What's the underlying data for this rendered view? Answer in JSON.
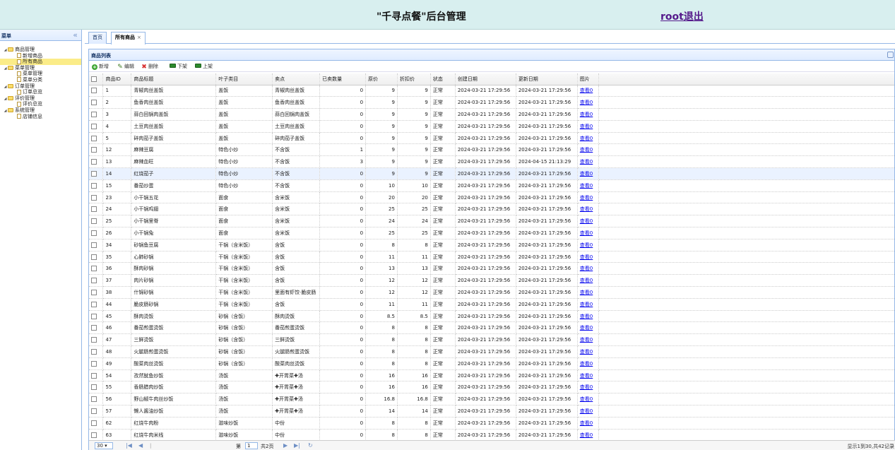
{
  "header": {
    "title": "\"千寻点餐\"后台管理",
    "logout": "root退出"
  },
  "sidebar": {
    "title": "菜单",
    "collapse": "«",
    "tree": [
      {
        "label": "商品管理",
        "level": 0,
        "type": "folder"
      },
      {
        "label": "新增商品",
        "level": 1,
        "type": "file"
      },
      {
        "label": "所有商品",
        "level": 1,
        "type": "file",
        "selected": true
      },
      {
        "label": "菜单管理",
        "level": 0,
        "type": "folder"
      },
      {
        "label": "菜单管理",
        "level": 1,
        "type": "file"
      },
      {
        "label": "菜单分类",
        "level": 1,
        "type": "file"
      },
      {
        "label": "订单管理",
        "level": 0,
        "type": "folder"
      },
      {
        "label": "订单总览",
        "level": 1,
        "type": "file"
      },
      {
        "label": "评价管理",
        "level": 0,
        "type": "folder"
      },
      {
        "label": "评价总览",
        "level": 1,
        "type": "file"
      },
      {
        "label": "系统管理",
        "level": 0,
        "type": "folder"
      },
      {
        "label": "店铺信息",
        "level": 1,
        "type": "file"
      }
    ]
  },
  "tabs": {
    "home": "首页",
    "all_products": "所有商品",
    "close": "×"
  },
  "grid": {
    "title": "商品列表",
    "toolbar": {
      "add": "新增",
      "edit": "编辑",
      "delete": "删除",
      "offline": "下架",
      "online": "上架"
    },
    "columns": [
      "商品ID",
      "商品标题",
      "叶子类目",
      "卖点",
      "已卖数量",
      "原价",
      "折扣价",
      "状态",
      "创建日期",
      "更新日期",
      "图片"
    ],
    "rows": [
      [
        "1",
        "青椒肉丝盖饭",
        "盖饭",
        "青椒肉丝盖饭",
        "0",
        "9",
        "9",
        "正常",
        "2024-03-21 17:29:56",
        "2024-03-21 17:29:56",
        "查看0"
      ],
      [
        "2",
        "鱼香肉丝盖饭",
        "盖饭",
        "鱼香肉丝盖饭",
        "0",
        "9",
        "9",
        "正常",
        "2024-03-21 17:29:56",
        "2024-03-21 17:29:56",
        "查看0"
      ],
      [
        "3",
        "蒜白回锅肉盖饭",
        "盖饭",
        "蒜白回锅肉盖饭",
        "0",
        "9",
        "9",
        "正常",
        "2024-03-21 17:29:56",
        "2024-03-21 17:29:56",
        "查看0"
      ],
      [
        "4",
        "土豆肉丝盖饭",
        "盖饭",
        "土豆肉丝盖饭",
        "0",
        "9",
        "9",
        "正常",
        "2024-03-21 17:29:56",
        "2024-03-21 17:29:56",
        "查看0"
      ],
      [
        "5",
        "碎肉茄子盖饭",
        "盖饭",
        "碎肉茄子盖饭",
        "0",
        "9",
        "9",
        "正常",
        "2024-03-21 17:29:56",
        "2024-03-21 17:29:56",
        "查看0"
      ],
      [
        "12",
        "麻辣豆腐",
        "特色小炒",
        "不含饭",
        "1",
        "9",
        "9",
        "正常",
        "2024-03-21 17:29:56",
        "2024-03-21 17:29:56",
        "查看0"
      ],
      [
        "13",
        "麻辣血旺",
        "特色小炒",
        "不含饭",
        "3",
        "9",
        "9",
        "正常",
        "2024-03-21 17:29:56",
        "2024-04-15 21:13:29",
        "查看0"
      ],
      [
        "14",
        "红烧茄子",
        "特色小炒",
        "不含饭",
        "0",
        "9",
        "9",
        "正常",
        "2024-03-21 17:29:56",
        "2024-03-21 17:29:56",
        "查看0"
      ],
      [
        "15",
        "番茄炒蛋",
        "特色小炒",
        "不含饭",
        "0",
        "10",
        "10",
        "正常",
        "2024-03-21 17:29:56",
        "2024-03-21 17:29:56",
        "查看0"
      ],
      [
        "23",
        "小干锅五花",
        "面食",
        "含米饭",
        "0",
        "20",
        "20",
        "正常",
        "2024-03-21 17:29:56",
        "2024-03-21 17:29:56",
        "查看0"
      ],
      [
        "24",
        "小干锅鸡翅",
        "面食",
        "含米饭",
        "0",
        "25",
        "25",
        "正常",
        "2024-03-21 17:29:56",
        "2024-03-21 17:29:56",
        "查看0"
      ],
      [
        "25",
        "小干锅里脊",
        "面食",
        "含米饭",
        "0",
        "24",
        "24",
        "正常",
        "2024-03-21 17:29:56",
        "2024-03-21 17:29:56",
        "查看0"
      ],
      [
        "26",
        "小干锅兔",
        "面食",
        "含米饭",
        "0",
        "25",
        "25",
        "正常",
        "2024-03-21 17:29:56",
        "2024-03-21 17:29:56",
        "查看0"
      ],
      [
        "34",
        "砂锅鱼豆腐",
        "干锅（含米饭）",
        "含饭",
        "0",
        "8",
        "8",
        "正常",
        "2024-03-21 17:29:56",
        "2024-03-21 17:29:56",
        "查看0"
      ],
      [
        "35",
        "心肺砂锅",
        "干锅（含米饭）",
        "含饭",
        "0",
        "11",
        "11",
        "正常",
        "2024-03-21 17:29:56",
        "2024-03-21 17:29:56",
        "查看0"
      ],
      [
        "36",
        "酥肉砂锅",
        "干锅（含米饭）",
        "含饭",
        "0",
        "13",
        "13",
        "正常",
        "2024-03-21 17:29:56",
        "2024-03-21 17:29:56",
        "查看0"
      ],
      [
        "37",
        "肉片砂锅",
        "干锅（含米饭）",
        "含饭",
        "0",
        "12",
        "12",
        "正常",
        "2024-03-21 17:29:56",
        "2024-03-21 17:29:56",
        "查看0"
      ],
      [
        "38",
        "什锦砂锅",
        "干锅（含米饭）",
        "里面有虾饺·脆皮肠",
        "0",
        "12",
        "12",
        "正常",
        "2024-03-21 17:29:56",
        "2024-03-21 17:29:56",
        "查看0"
      ],
      [
        "44",
        "脆皮肠砂锅",
        "干锅（含米饭）",
        "含饭",
        "0",
        "11",
        "11",
        "正常",
        "2024-03-21 17:29:56",
        "2024-03-21 17:29:56",
        "查看0"
      ],
      [
        "45",
        "酥肉烫饭",
        "砂锅（含饭）",
        "酥肉烫饭",
        "0",
        "8.5",
        "8.5",
        "正常",
        "2024-03-21 17:29:56",
        "2024-03-21 17:29:56",
        "查看0"
      ],
      [
        "46",
        "番茄煎蛋烫饭",
        "砂锅（含饭）",
        "番茄煎蛋烫饭",
        "0",
        "8",
        "8",
        "正常",
        "2024-03-21 17:29:56",
        "2024-03-21 17:29:56",
        "查看0"
      ],
      [
        "47",
        "三鲜烫饭",
        "砂锅（含饭）",
        "三鲜烫饭",
        "0",
        "8",
        "8",
        "正常",
        "2024-03-21 17:29:56",
        "2024-03-21 17:29:56",
        "查看0"
      ],
      [
        "48",
        "火腿肠煎蛋烫饭",
        "砂锅（含饭）",
        "火腿肠煎蛋烫饭",
        "0",
        "8",
        "8",
        "正常",
        "2024-03-21 17:29:56",
        "2024-03-21 17:29:56",
        "查看0"
      ],
      [
        "49",
        "酸菜肉丝烫饭",
        "砂锅（含饭）",
        "酸菜肉丝烫饭",
        "0",
        "8",
        "8",
        "正常",
        "2024-03-21 17:29:56",
        "2024-03-21 17:29:56",
        "查看0"
      ],
      [
        "54",
        "孜然鱿鱼炒饭",
        "汤饭",
        "✚开胃菜✚汤",
        "0",
        "16",
        "16",
        "正常",
        "2024-03-21 17:29:56",
        "2024-03-21 17:29:56",
        "查看0"
      ],
      [
        "55",
        "香肠腊肉炒饭",
        "汤饭",
        "✚开胃菜✚汤",
        "0",
        "16",
        "16",
        "正常",
        "2024-03-21 17:29:56",
        "2024-03-21 17:29:56",
        "查看0"
      ],
      [
        "56",
        "野山椒牛肉丝炒饭",
        "汤饭",
        "✚开胃菜✚汤",
        "0",
        "16.8",
        "16.8",
        "正常",
        "2024-03-21 17:29:56",
        "2024-03-21 17:29:56",
        "查看0"
      ],
      [
        "57",
        "懒人酱油炒饭",
        "汤饭",
        "✚开胃菜✚汤",
        "0",
        "14",
        "14",
        "正常",
        "2024-03-21 17:29:56",
        "2024-03-21 17:29:56",
        "查看0"
      ],
      [
        "62",
        "红烧牛肉粉",
        "滋味炒饭",
        "中份",
        "0",
        "8",
        "8",
        "正常",
        "2024-03-21 17:29:56",
        "2024-03-21 17:29:56",
        "查看0"
      ],
      [
        "63",
        "红烧牛肉米线",
        "滋味炒饭",
        "中份",
        "0",
        "8",
        "8",
        "正常",
        "2024-03-21 17:29:56",
        "2024-03-21 17:29:56",
        "查看0"
      ]
    ],
    "highlight_row_id": "14"
  },
  "pager": {
    "page_size": "30",
    "page_label": "第",
    "page_value": "1",
    "total_pages": "共2页",
    "info": "显示1到30,共42记录"
  }
}
